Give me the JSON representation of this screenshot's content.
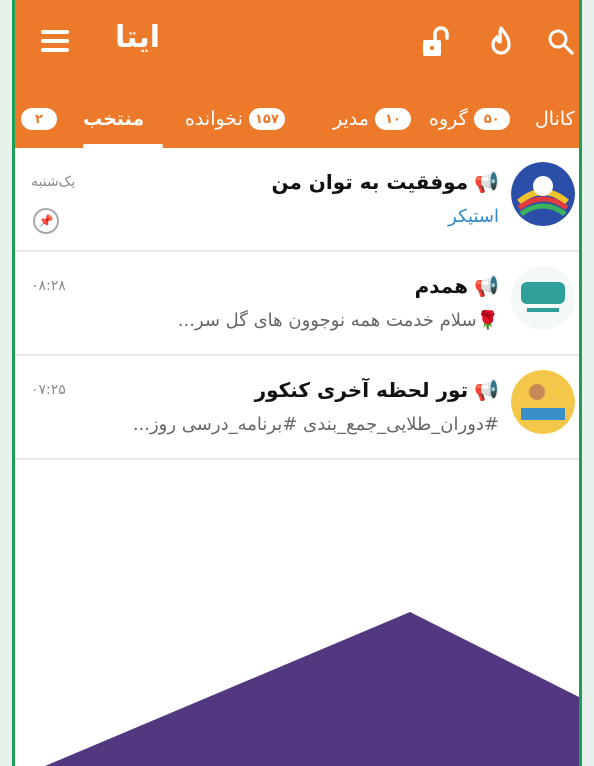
{
  "app": {
    "title": "ایتا"
  },
  "tabs": [
    {
      "label": "کانال",
      "badge": "۵۰",
      "active": false
    },
    {
      "label": "گروه",
      "badge": "۱۰",
      "active": false
    },
    {
      "label": "مدیر",
      "badge": "۱۵۷",
      "active": false
    },
    {
      "label": "نخوانده",
      "badge": "",
      "active": false
    },
    {
      "label": "منتخب",
      "badge": "۲",
      "active": true
    }
  ],
  "chats": [
    {
      "title": "موفقیت به توان من",
      "message": "استیکر",
      "time": "یک‌شنبه",
      "pinned": true
    },
    {
      "title": "همدم",
      "message": "🌹سلام خدمت همه نوجوون های گل سر...",
      "time": "۰۸:۲۸",
      "pinned": false
    },
    {
      "title": "تور لحظه آخری کنکور",
      "message": "#دوران_طلایی_جمع_بندی #برنامه_درسی روز...",
      "time": "۰۷:۲۵",
      "pinned": false
    }
  ],
  "colors": {
    "accent": "#ec7a2a",
    "frame": "#1e9e55",
    "purple": "#52387f"
  }
}
